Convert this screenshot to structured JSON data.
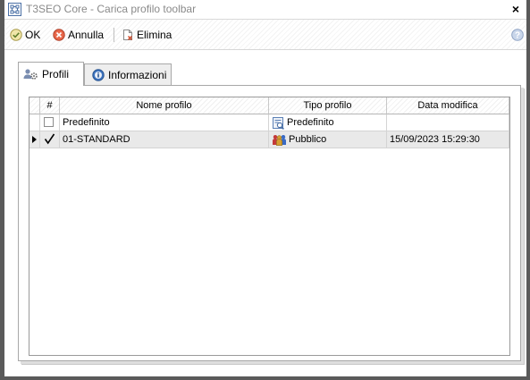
{
  "window": {
    "title": "T3SEO Core - Carica profilo toolbar",
    "close_symbol": "×"
  },
  "toolbar": {
    "ok_label": "OK",
    "annulla_label": "Annulla",
    "elimina_label": "Elimina"
  },
  "tabs": [
    {
      "label": "Profili",
      "active": true
    },
    {
      "label": "Informazioni",
      "active": false
    }
  ],
  "grid": {
    "columns": [
      "#",
      "Nome profilo",
      "Tipo profilo",
      "Data modifica"
    ],
    "rows": [
      {
        "checked": false,
        "nome": "Predefinito",
        "tipo": "Predefinito",
        "tipo_icon": "preset-icon",
        "data": "",
        "current": false
      },
      {
        "checked": true,
        "nome": "01-STANDARD",
        "tipo": "Pubblico",
        "tipo_icon": "users-group-icon",
        "data": "15/09/2023 15:29:30",
        "current": true
      }
    ]
  },
  "colors": {
    "window_border": "#5a5a5a",
    "title_text": "#8a8a8a",
    "selected_row": "#e9e9e9"
  }
}
